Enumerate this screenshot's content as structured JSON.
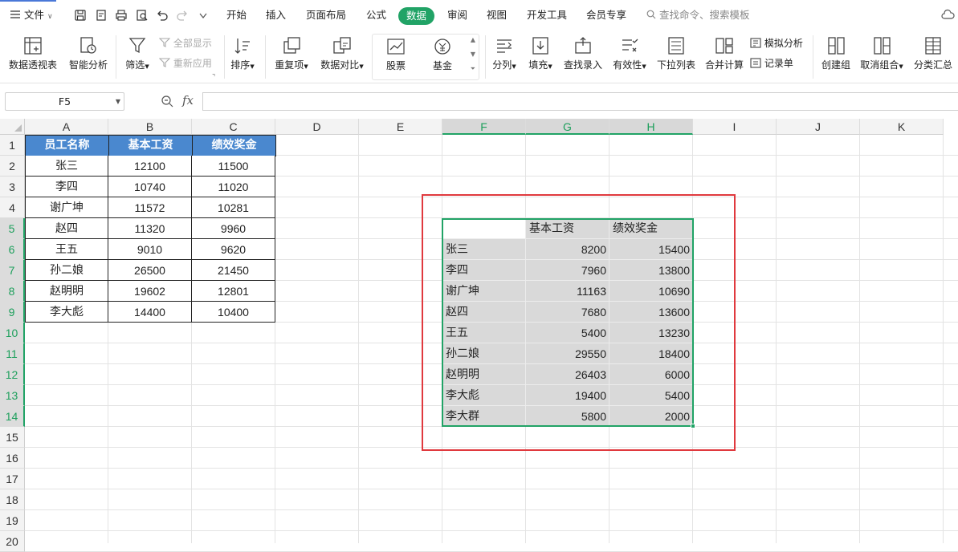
{
  "menubar": {
    "file_label": "文件",
    "tabs": [
      "开始",
      "插入",
      "页面布局",
      "公式",
      "数据",
      "审阅",
      "视图",
      "开发工具",
      "会员专享"
    ],
    "active_tab": "数据",
    "search_placeholder": "查找命令、搜索模板"
  },
  "ribbon": {
    "pivot": "数据透视表",
    "smart_analysis": "智能分析",
    "filter": "筛选",
    "show_all": "全部显示",
    "reapply": "重新应用",
    "sort": "排序",
    "duplicates": "重复项",
    "compare": "数据对比",
    "stock": "股票",
    "fund": "基金",
    "split_column": "分列",
    "fill": "填充",
    "lookup_entry": "查找录入",
    "validity": "有效性",
    "dropdown_list": "下拉列表",
    "consolidate": "合并计算",
    "what_if": "模拟分析",
    "record_sheet": "记录单",
    "create_group": "创建组",
    "ungroup": "取消组合",
    "subtotal": "分类汇总"
  },
  "formula_bar": {
    "name_box": "F5",
    "fx_label": "fx",
    "formula": ""
  },
  "grid": {
    "columns": [
      "A",
      "B",
      "C",
      "D",
      "E",
      "F",
      "G",
      "H",
      "I",
      "J",
      "K"
    ],
    "selected_columns": [
      "F",
      "G",
      "H"
    ],
    "rows": [
      "1",
      "2",
      "3",
      "4",
      "5",
      "6",
      "7",
      "8",
      "9",
      "10",
      "11",
      "12",
      "13",
      "14",
      "15",
      "16",
      "17",
      "18",
      "19",
      "20"
    ],
    "selected_rows": [
      "5",
      "6",
      "7",
      "8",
      "9",
      "10",
      "11",
      "12",
      "13",
      "14"
    ]
  },
  "left_table": {
    "headers": [
      "员工名称",
      "基本工资",
      "绩效奖金"
    ],
    "rows": [
      [
        "张三",
        "12100",
        "11500"
      ],
      [
        "李四",
        "10740",
        "11020"
      ],
      [
        "谢广坤",
        "11572",
        "10281"
      ],
      [
        "赵四",
        "11320",
        "9960"
      ],
      [
        "王五",
        "9010",
        "9620"
      ],
      [
        "孙二娘",
        "26500",
        "21450"
      ],
      [
        "赵明明",
        "19602",
        "12801"
      ],
      [
        "李大彪",
        "14400",
        "10400"
      ]
    ]
  },
  "right_table": {
    "headers": [
      "",
      "基本工资",
      "绩效奖金"
    ],
    "rows": [
      [
        "张三",
        "8200",
        "15400"
      ],
      [
        "李四",
        "7960",
        "13800"
      ],
      [
        "谢广坤",
        "11163",
        "10690"
      ],
      [
        "赵四",
        "7680",
        "13600"
      ],
      [
        "王五",
        "5400",
        "13230"
      ],
      [
        "孙二娘",
        "29550",
        "18400"
      ],
      [
        "赵明明",
        "26403",
        "6000"
      ],
      [
        "李大彪",
        "19400",
        "5400"
      ],
      [
        "李大群",
        "5800",
        "2000"
      ]
    ]
  },
  "colors": {
    "active_tab": "#21a366",
    "header_fill": "#4a88cf",
    "highlight_box": "#e0393e",
    "selection": "#21a366"
  }
}
